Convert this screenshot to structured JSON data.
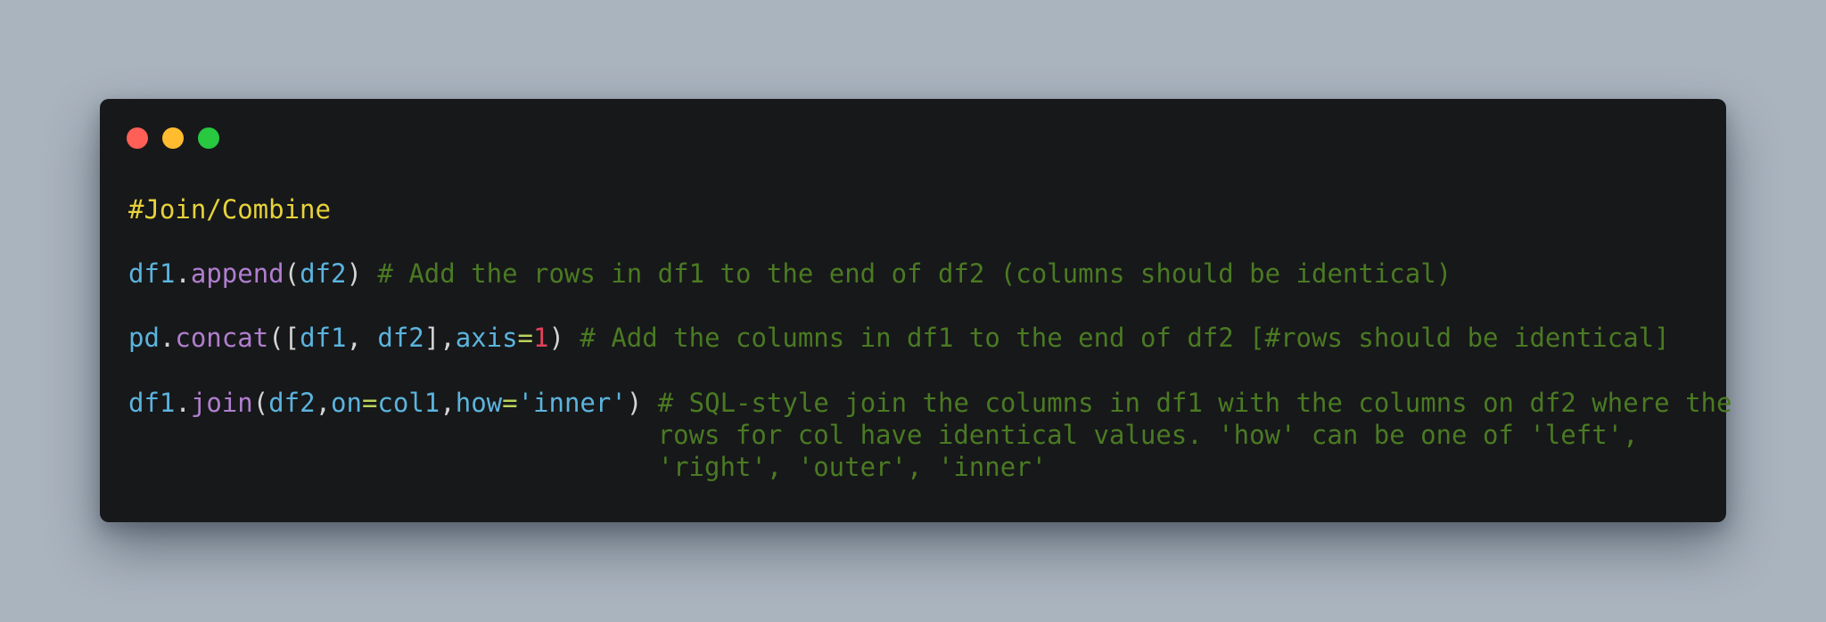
{
  "window": {
    "controls": [
      "close",
      "minimize",
      "maximize"
    ],
    "colors": {
      "background": "#17181a",
      "close": "#ff5f57",
      "minimize": "#febc2e",
      "maximize": "#28c840"
    }
  },
  "code": {
    "heading": "#Join/Combine",
    "line_append": {
      "obj": "df1",
      "dot": ".",
      "method": "append",
      "open": "(",
      "arg": "df2",
      "close": ")",
      "comment": " # Add the rows in df1 to the end of df2 (columns should be identical)"
    },
    "line_concat": {
      "obj": "pd",
      "dot": ".",
      "method": "concat",
      "open": "([",
      "arg1": "df1",
      "sep": ", ",
      "arg2": "df2",
      "mid": "],",
      "kw": "axis",
      "eq": "=",
      "num": "1",
      "close": ")",
      "comment": " # Add the columns in df1 to the end of df2 [#rows should be identical]"
    },
    "line_join": {
      "obj": "df1",
      "dot": ".",
      "method": "join",
      "open": "(",
      "arg": "df2",
      "comma1": ",",
      "kw1": "on",
      "eq1": "=",
      "val1": "col1",
      "comma2": ",",
      "kw2": "how",
      "eq2": "=",
      "val2": "'inner'",
      "close": ")",
      "comment1": " # SQL-style join the columns in df1 with the columns on df2 where the",
      "comment2": "                                  rows for col have identical values. 'how' can be one of 'left',",
      "comment3": "                                  'right', 'outer', 'inner'"
    }
  }
}
